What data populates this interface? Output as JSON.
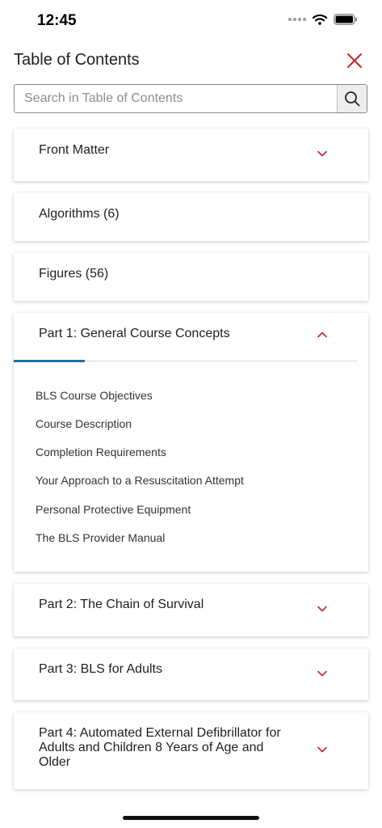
{
  "status_bar": {
    "time": "12:45"
  },
  "header": {
    "title": "Table of Contents"
  },
  "search": {
    "placeholder": "Search in Table of Contents"
  },
  "sections": [
    {
      "label": "Front Matter",
      "expandable": true
    },
    {
      "label": "Algorithms (6)"
    },
    {
      "label": "Figures (56)"
    },
    {
      "label": "Part 1: General Course Concepts",
      "expanded": true,
      "items": [
        "BLS Course Objectives",
        "Course Description",
        "Completion Requirements",
        "Your Approach to a Resuscitation Attempt",
        "Personal Protective Equipment",
        "The BLS Provider Manual"
      ]
    },
    {
      "label": "Part 2: The Chain of Survival",
      "expandable": true
    },
    {
      "label": "Part 3: BLS for Adults",
      "expandable": true
    },
    {
      "label": "Part 4: Automated External Defibrillator for Adults and Children 8 Years of Age and Older",
      "expandable": true
    }
  ],
  "colors": {
    "accent_red": "#c0272d",
    "tab_blue": "#1b6fa8"
  }
}
